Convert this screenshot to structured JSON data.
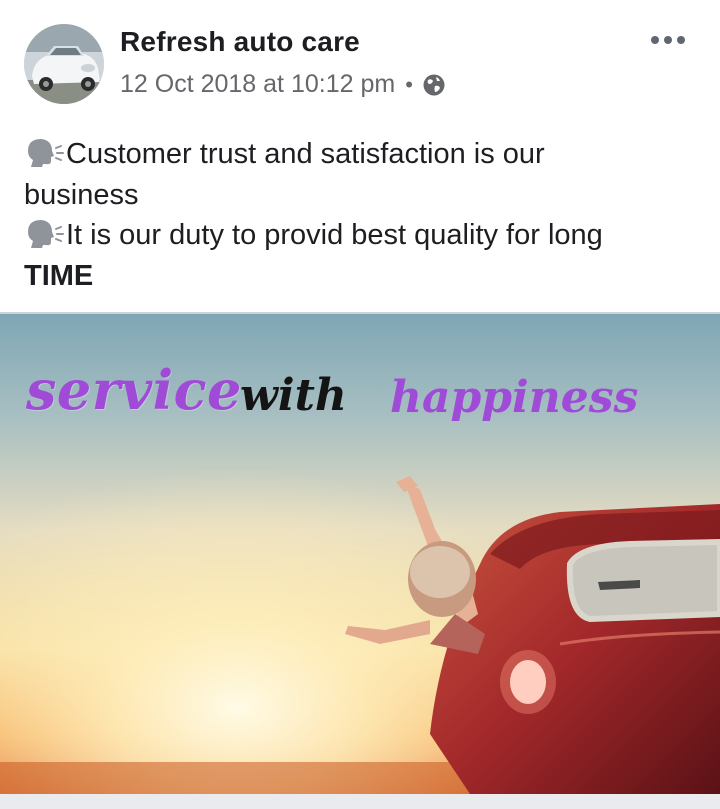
{
  "post": {
    "author": "Refresh auto care",
    "timestamp": "12 Oct 2018 at 10:12 pm",
    "separator": "•",
    "privacy_icon": "globe-icon",
    "more_icon": "more-options-icon",
    "text_lines": [
      "Customer trust and satisfaction is our",
      "business",
      "It is our duty to provid best  quality for long",
      "TIME"
    ],
    "line_icon": "speaking-head-icon"
  },
  "image": {
    "word1": "service",
    "word2": "with",
    "word3": "happiness",
    "accent_color": "#a04ad8"
  },
  "colors": {
    "text": "#1c1e21",
    "meta": "#65676b"
  }
}
